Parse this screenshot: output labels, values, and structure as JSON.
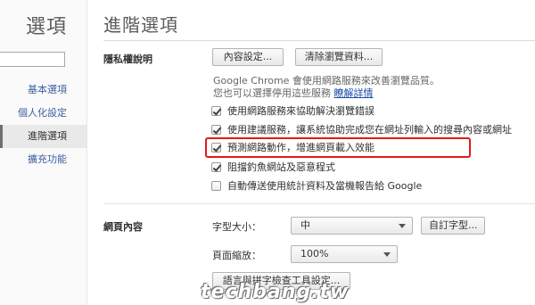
{
  "sidebar": {
    "title": "選項",
    "items": [
      {
        "label": "基本選項"
      },
      {
        "label": "個人化設定"
      },
      {
        "label": "進階選項"
      },
      {
        "label": "擴充功能"
      }
    ]
  },
  "main": {
    "title": "進階選項",
    "privacy": {
      "title": "隱私權說明",
      "content_settings_button": "內容設定...",
      "clear_data_button": "清除瀏覽資料...",
      "desc_line1": "Google Chrome 會使用網路服務來改善瀏覽品質。",
      "desc_line2": "您也可以選擇停用這些服務",
      "learn_more": "瞭解詳情",
      "options": [
        {
          "label": "使用網路服務來協助解決瀏覽錯誤",
          "checked": true
        },
        {
          "label": "使用建議服務，讓系統協助完成您在網址列輸入的搜尋內容或網址",
          "checked": true
        },
        {
          "label": "預測網路動作，增進網頁載入效能",
          "checked": true
        },
        {
          "label": "阻擋釣魚網站及惡意程式",
          "checked": true
        },
        {
          "label": "自動傳送使用統計資料及當機報告給 Google",
          "checked": false
        }
      ]
    },
    "web_content": {
      "title": "網頁內容",
      "font_size_label": "字型大小：",
      "font_size_value": "中",
      "customize_fonts_button": "自訂字型...",
      "page_zoom_label": "頁面縮放：",
      "page_zoom_value": "100%",
      "spellcheck_button": "語言與拼字檢查工具設定..."
    }
  },
  "watermark": {
    "text": "techbang.tw"
  },
  "colors": {
    "highlight": "#e01a1a",
    "link": "#1a4aa8"
  }
}
